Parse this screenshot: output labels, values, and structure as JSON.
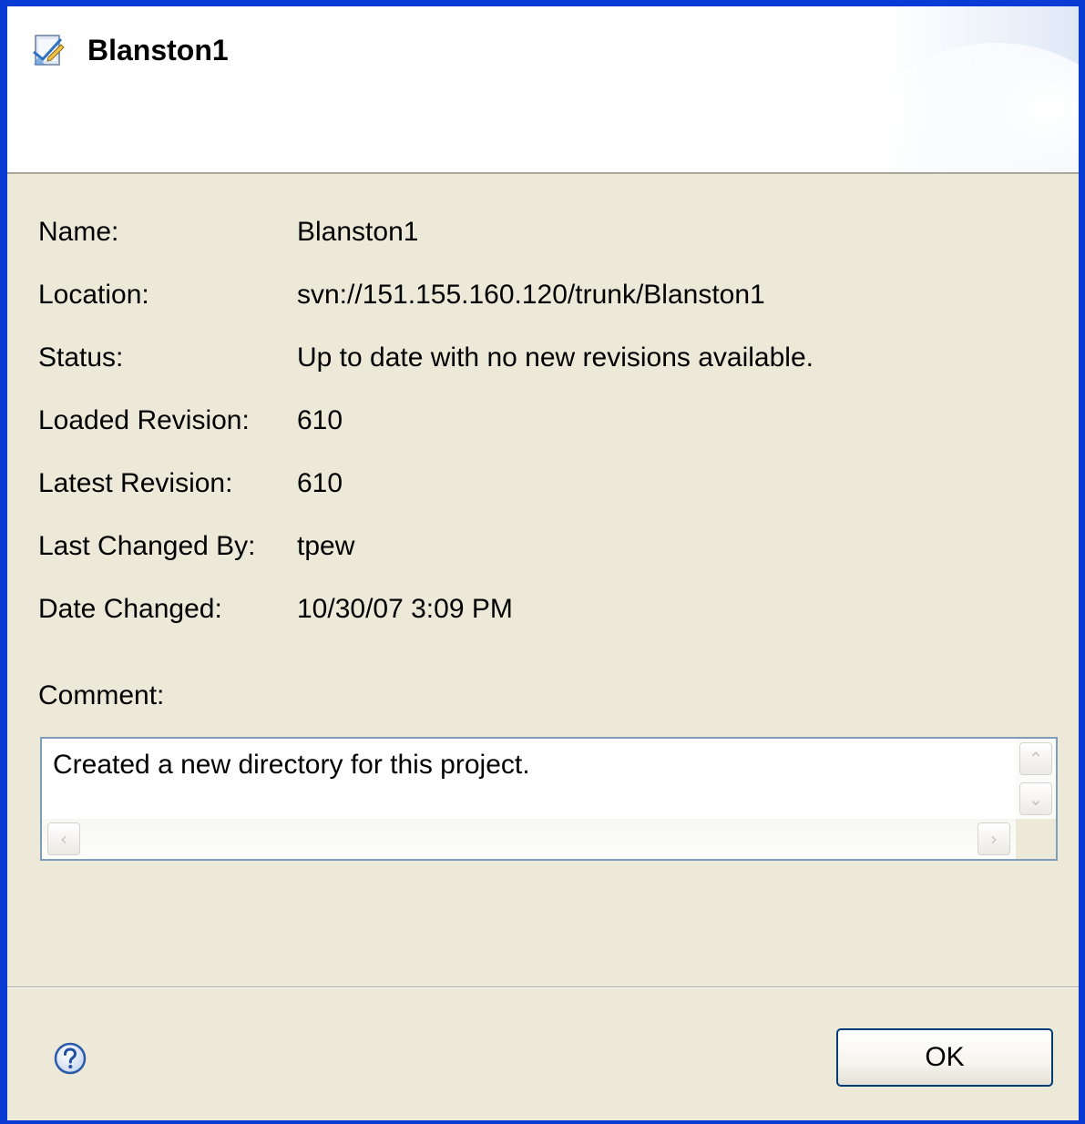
{
  "dialog": {
    "title": "Blanston1",
    "title_icon": "svn-properties-icon"
  },
  "fields": [
    {
      "label": "Name:",
      "value": "Blanston1"
    },
    {
      "label": "Location:",
      "value": "svn://151.155.160.120/trunk/Blanston1"
    },
    {
      "label": "Status:",
      "value": "Up to date with no new revisions available."
    },
    {
      "label": "Loaded Revision:",
      "value": "610"
    },
    {
      "label": "Latest Revision:",
      "value": "610"
    },
    {
      "label": "Last Changed By:",
      "value": "tpew"
    },
    {
      "label": "Date Changed:",
      "value": "10/30/07 3:09 PM"
    }
  ],
  "comment": {
    "label": "Comment:",
    "text": "Created a new directory for this project."
  },
  "footer": {
    "help_icon": "help-icon",
    "ok_label": "OK"
  },
  "colors": {
    "window_border": "#0a3bd4",
    "dialog_background": "#ece9d8",
    "field_border": "#7f9db9"
  }
}
